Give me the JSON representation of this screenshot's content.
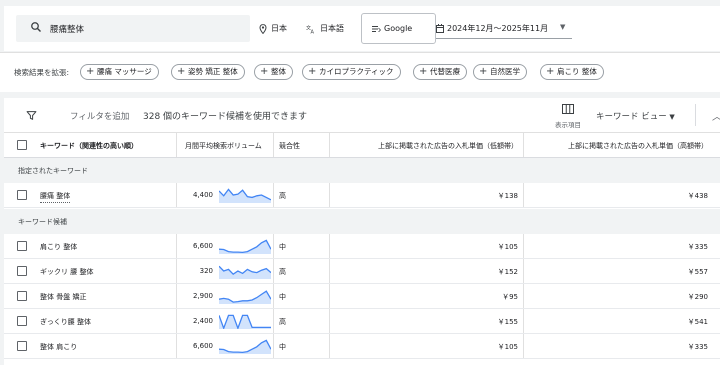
{
  "search": {
    "keyword": "腰痛整体"
  },
  "targeting": {
    "location": "日本",
    "language": "日本語",
    "network": "Google",
    "date_range": "2024年12月〜2025年11月"
  },
  "expand": {
    "label": "検索結果を拡張:",
    "chips": [
      "腰痛 マッサージ",
      "姿勢 矯正 整体",
      "整体",
      "カイロプラクティック",
      "代替医療",
      "自然医学",
      "肩こり 整体"
    ]
  },
  "toolbar": {
    "filter_add": "フィルタを追加",
    "count_text": "328 個のキーワード候補を使用できます",
    "columns_label": "表示項目",
    "view_label": "キーワード ビュー"
  },
  "columns": {
    "keyword": "キーワード（関連性の高い順）",
    "volume": "月間平均検索ボリューム",
    "competition": "競合性",
    "bid_low": "上部に掲載された広告の入札単価（低額帯）",
    "bid_high": "上部に掲載された広告の入札単価（高額帯）"
  },
  "groups": {
    "specified": "指定されたキーワード",
    "ideas": "キーワード候補"
  },
  "specified_rows": [
    {
      "keyword": "腰痛 整体",
      "volume": "4,400",
      "competition": "高",
      "bid_low": "￥138",
      "bid_high": "￥438",
      "trend": [
        0.75,
        0.45,
        0.85,
        0.5,
        0.55,
        0.8,
        0.4,
        0.35,
        0.45,
        0.5,
        0.35,
        0.2
      ]
    }
  ],
  "idea_rows": [
    {
      "keyword": "肩こり 整体",
      "volume": "6,600",
      "competition": "中",
      "bid_low": "￥105",
      "bid_high": "￥335",
      "trend": [
        0.3,
        0.28,
        0.15,
        0.12,
        0.12,
        0.1,
        0.15,
        0.3,
        0.45,
        0.7,
        0.85,
        0.3
      ]
    },
    {
      "keyword": "ギックリ 腰 整体",
      "volume": "320",
      "competition": "高",
      "bid_low": "￥152",
      "bid_high": "￥557",
      "trend": [
        0.8,
        0.5,
        0.6,
        0.3,
        0.5,
        0.35,
        0.6,
        0.45,
        0.4,
        0.55,
        0.65,
        0.4
      ]
    },
    {
      "keyword": "整体 骨盤 矯正",
      "volume": "2,900",
      "competition": "中",
      "bid_low": "￥95",
      "bid_high": "￥290",
      "trend": [
        0.3,
        0.35,
        0.3,
        0.12,
        0.15,
        0.2,
        0.2,
        0.25,
        0.4,
        0.6,
        0.8,
        0.3
      ]
    },
    {
      "keyword": "ぎっくり腰 整体",
      "volume": "2,400",
      "competition": "高",
      "bid_low": "￥155",
      "bid_high": "￥541",
      "trend": [
        0.85,
        0.05,
        0.85,
        0.85,
        0.05,
        0.85,
        0.85,
        0.1,
        0.1,
        0.1,
        0.1,
        0.1
      ]
    },
    {
      "keyword": "整体 肩こり",
      "volume": "6,600",
      "competition": "中",
      "bid_low": "￥105",
      "bid_high": "￥335",
      "trend": [
        0.3,
        0.28,
        0.15,
        0.12,
        0.12,
        0.1,
        0.15,
        0.3,
        0.45,
        0.7,
        0.85,
        0.3
      ]
    }
  ],
  "colors": {
    "spark_line": "#4285f4",
    "spark_fill": "#d2e3fc",
    "group_bg": "#f1f3f4"
  }
}
